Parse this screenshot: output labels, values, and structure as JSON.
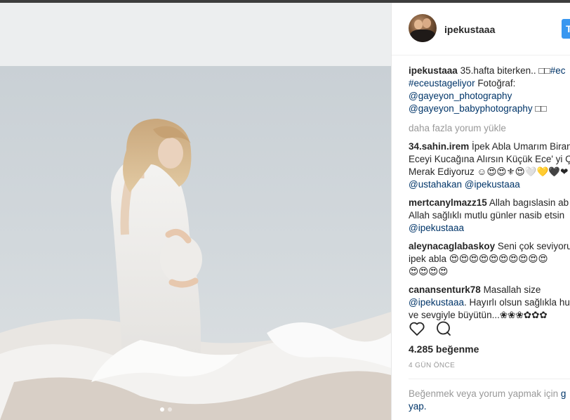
{
  "post": {
    "username": "ipekustaaa",
    "follow_label": "T",
    "caption": {
      "username": "ipekustaaa",
      "text": "35.hafta biterken.. □□",
      "hashtag1": "#ec",
      "hashtag2": "#eceustageliyor",
      "credit_text": " Fotoğraf:",
      "mention1": "@gayeyon_photography",
      "mention2": "@gayeyon_babyphotography",
      "mention2_suffix": " □□"
    },
    "load_more": "daha fazla yorum yükle",
    "comments": [
      {
        "username": "34.sahin.irem",
        "line1": " İpek Abla Umarım Biran",
        "line2": "Eceyi Kucağına Alırsın Küçük Ece' yi Ç",
        "line3": "Merak Ediyoruz ☺😍😍⚜😍🤍💛🖤❤",
        "mention_a": "@ustahakan",
        "mention_b": "@ipekustaaa"
      },
      {
        "username": "mertcanylmazz15",
        "line1": " Allah bagıslasin ab",
        "line2": "Allah sağlıklı mutlu günler nasib etsin",
        "mention_a": "@ipekustaaa"
      },
      {
        "username": "aleynacaglabaskoy",
        "line1": " Seni çok seviyoru",
        "line2": "ipek abla 😍😍😍😍😍😍😍😍😍😍",
        "line3": "😍😍😍😍"
      },
      {
        "username": "canansenturk78",
        "line1": " Masallah size",
        "mention_a": "@ipekustaaa",
        "line2": ". Hayırlı olsun sağlıkla hu",
        "line3": "ve sevgiyle büyütün...❀❀❀✿✿✿"
      }
    ],
    "likes": "4.285 beğenme",
    "time": "4 GÜN ÖNCE",
    "login_text": "Beğenmek veya yorum yapmak için ",
    "login_link": "g",
    "login_link2": "yap."
  },
  "carousel": {
    "count": 2,
    "active_index": 0
  },
  "icons": {
    "like": "heart-icon",
    "comment": "comment-icon"
  },
  "colors": {
    "link": "#003569",
    "muted": "#999999",
    "accent": "#3897f0"
  }
}
